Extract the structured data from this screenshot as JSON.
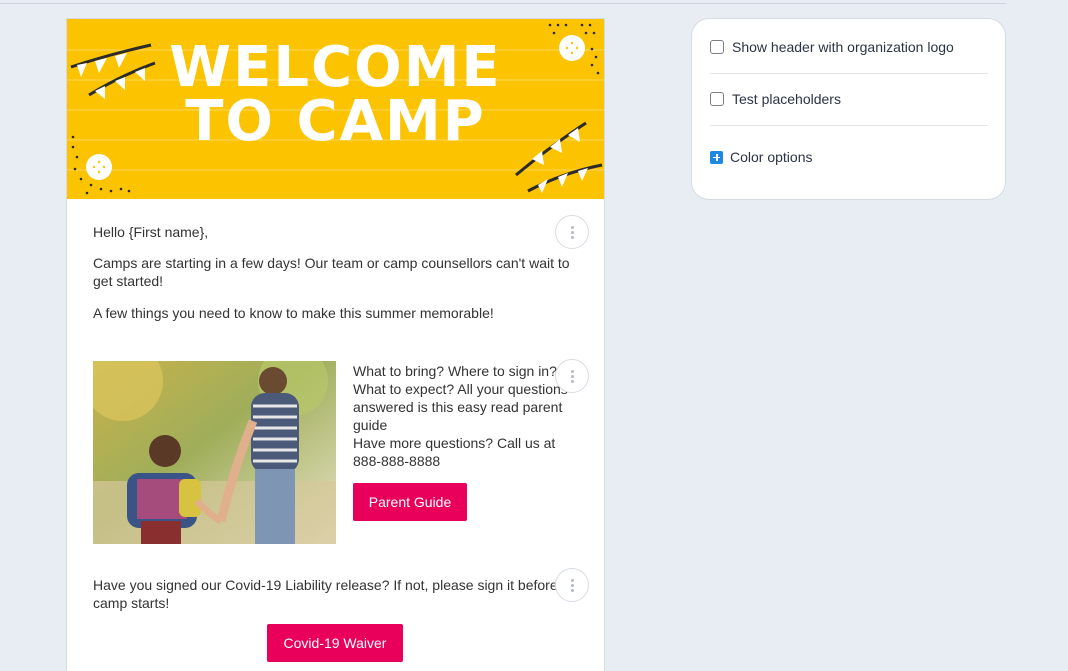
{
  "email": {
    "banner": {
      "line1": "WELCOME",
      "line2": "TO CAMP",
      "background": "#fcc300"
    },
    "greeting": "Hello {First name},",
    "intro": "Camps are starting in a few days! Our team or camp counsellors can't wait to get started!",
    "intro2": "A few things you need to know to make this summer memorable!",
    "guide_block": {
      "text_lines": [
        "What to bring? Where to sign in?",
        "What to expect? All your questions",
        "answered is this easy read parent",
        "guide",
        "Have more questions? Call us at",
        "888-888-8888"
      ],
      "button_label": "Parent Guide"
    },
    "waiver_block": {
      "text": "Have you signed our Covid-19 Liability release? If not, please sign it before camp starts!",
      "button_label": "Covid-19 Waiver"
    },
    "accent_color": "#e8005a"
  },
  "panel": {
    "options": [
      {
        "label": "Show header with organization logo",
        "checked": false
      },
      {
        "label": "Test placeholders",
        "checked": false
      }
    ],
    "color_options_label": "Color options"
  }
}
